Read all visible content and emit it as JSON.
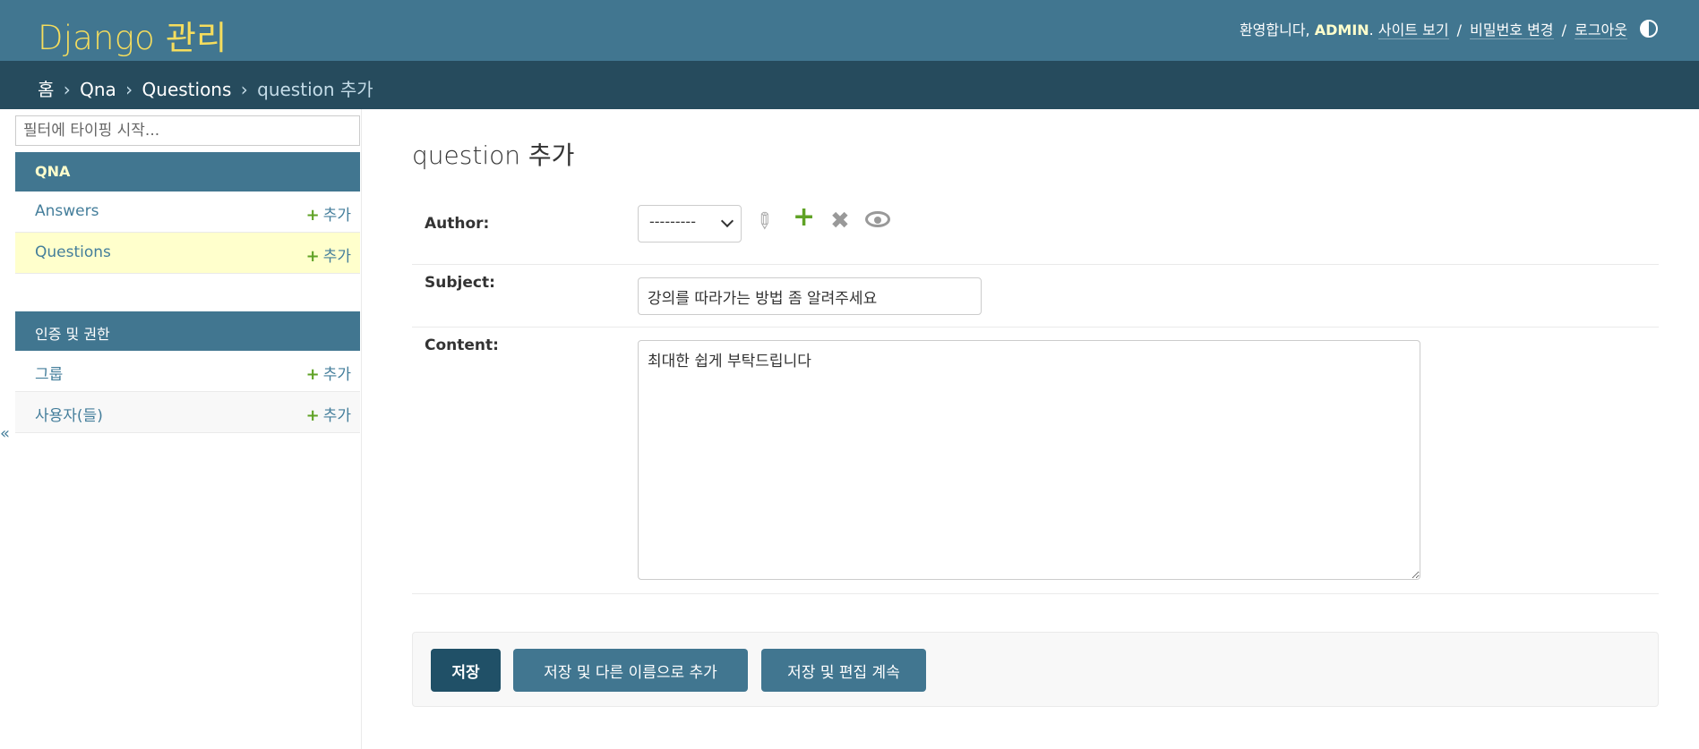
{
  "header": {
    "brand": "Django 관리",
    "welcome": "환영합니다,",
    "username": "ADMIN",
    "links": {
      "view_site": "사이트 보기",
      "change_password": "비밀번호 변경",
      "logout": "로그아웃"
    },
    "separator": "/"
  },
  "breadcrumbs": {
    "home": "홈",
    "app": "Qna",
    "model": "Questions",
    "current": "question 추가",
    "sep": "›"
  },
  "sidebar": {
    "filter_placeholder": "필터에 타이핑 시작...",
    "modules": [
      {
        "caption": "QNA",
        "models": [
          {
            "label": "Answers",
            "add": "추가"
          },
          {
            "label": "Questions",
            "add": "추가"
          }
        ]
      },
      {
        "caption": "인증 및 권한",
        "models": [
          {
            "label": "그룹",
            "add": "추가"
          },
          {
            "label": "사용자(들)",
            "add": "추가"
          }
        ]
      }
    ],
    "toggle": "«"
  },
  "form": {
    "title": "question 추가",
    "author": {
      "label": "Author:",
      "value": "---------"
    },
    "subject": {
      "label": "Subject:",
      "value": "강의를 따라가는 방법 좀 알려주세요"
    },
    "content": {
      "label": "Content:",
      "value": "최대한 쉽게 부탁드립니다"
    },
    "buttons": {
      "save": "저장",
      "save_add_another": "저장 및 다른 이름으로 추가",
      "save_continue": "저장 및 편집 계속"
    }
  },
  "colors": {
    "header_bg": "#417690",
    "breadcrumbs_bg": "#264b5d",
    "brand": "#f5dd5d",
    "add_plus": "#5fa225",
    "primary_button": "#205067"
  }
}
